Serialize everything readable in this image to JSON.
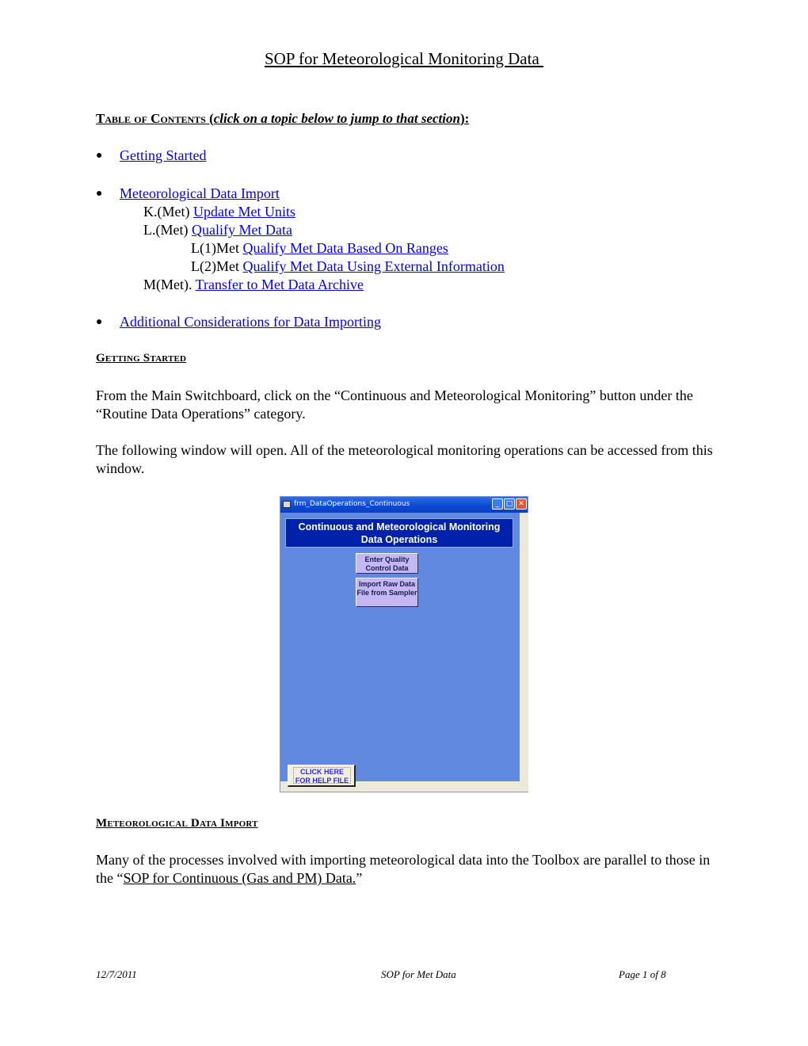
{
  "title": "SOP for Meteorological Monitoring Data ",
  "toc": {
    "heading_smallcaps": "Table of Contents",
    "heading_open": " (",
    "heading_italic": "click on a topic below to jump to that section",
    "heading_close": "):",
    "items": [
      {
        "label": "Getting Started"
      },
      {
        "label": "Meteorological Data Import",
        "sub": [
          {
            "prefix": "K.(Met) ",
            "label": "Update Met Units"
          },
          {
            "prefix": "L.(Met) ",
            "label": "Qualify Met Data"
          },
          {
            "prefix": "L(1)Met ",
            "label": "Qualify Met Data Based On Ranges"
          },
          {
            "prefix": "L(2)Met ",
            "label": "Qualify Met Data Using External Information"
          },
          {
            "prefix": "M(Met). ",
            "label": "Transfer to Met Data Archive"
          }
        ]
      },
      {
        "label": "Additional Considerations for Data Importing"
      }
    ]
  },
  "getting_started": {
    "heading": "Getting Started",
    "para1": "From the Main Switchboard, click on the “Continuous and Meteorological Monitoring” button under the “Routine Data Operations” category.",
    "para2": "The following window will open.  All of the meteorological monitoring operations can be accessed from this window."
  },
  "window": {
    "title": "frm_DataOperations_Continuous",
    "header_line1": "Continuous and Meteorological Monitoring",
    "header_line2": "Data Operations",
    "button1": "Enter Quality Control Data",
    "button2": "Import Raw Data File from Sampler",
    "help_line1": "CLICK HERE",
    "help_line2": "FOR HELP FILE",
    "minimize_glyph": "_",
    "maximize_glyph": "□",
    "close_glyph": "✕"
  },
  "met_import": {
    "heading": "Meteorological Data Import",
    "para_before": "Many of the processes involved with importing meteorological data into the Toolbox are parallel to those in the “",
    "link": "SOP for Continuous (Gas and PM) Data.",
    "para_after": "”"
  },
  "footer": {
    "date": "12/7/2011",
    "center": "SOP for Met Data",
    "page": "Page 1 of 8"
  }
}
